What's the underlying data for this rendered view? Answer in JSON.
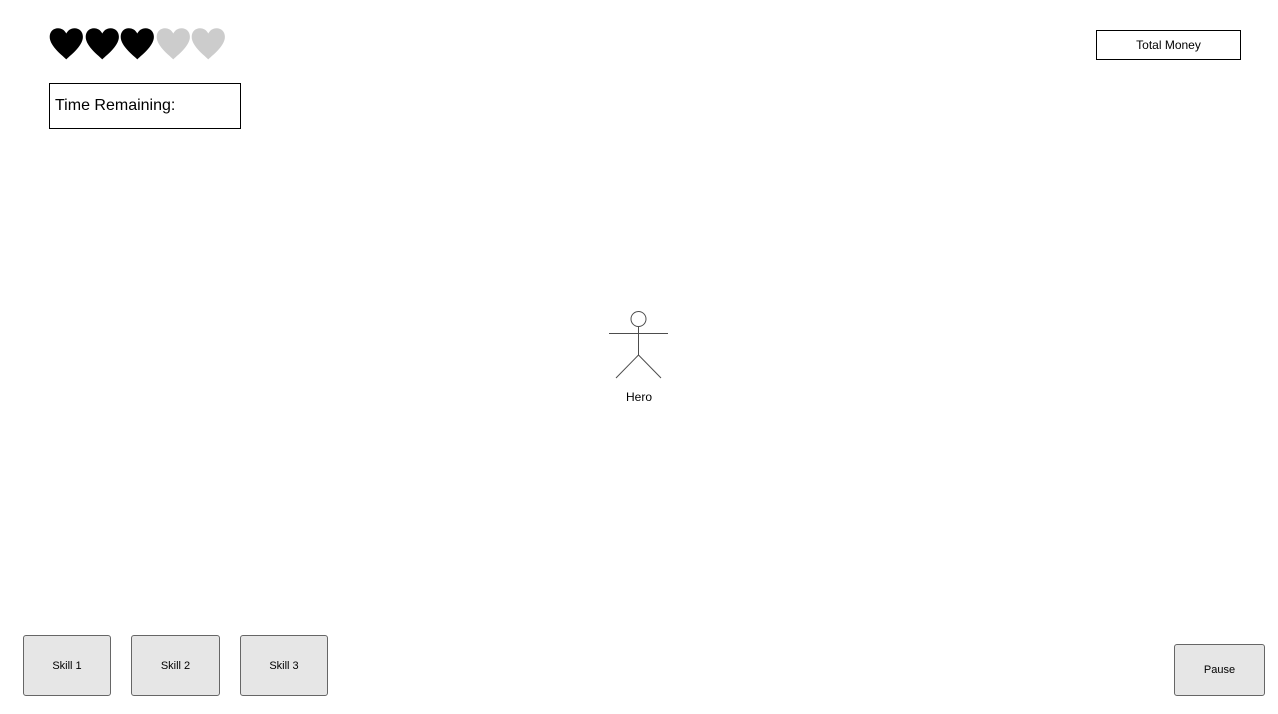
{
  "hud": {
    "lives": {
      "total": 5,
      "filled": 3,
      "filled_color": "#000000",
      "empty_color": "#cccccc"
    },
    "time_label": "Time Remaining:",
    "money_label": "Total Money"
  },
  "hero": {
    "label": "Hero"
  },
  "skills": [
    {
      "label": "Skill 1"
    },
    {
      "label": "Skill 2"
    },
    {
      "label": "Skill 3"
    }
  ],
  "pause_label": "Pause"
}
